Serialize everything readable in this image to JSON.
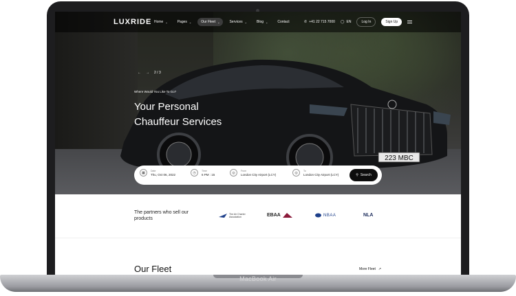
{
  "device_label": "MacBook Air",
  "nav": {
    "logo": "LUXRIDE",
    "menu": [
      {
        "label": "Home",
        "active": false
      },
      {
        "label": "Pages",
        "active": false
      },
      {
        "label": "Our Fleet",
        "active": true
      },
      {
        "label": "Services",
        "active": false
      },
      {
        "label": "Blog",
        "active": false
      },
      {
        "label": "Contact",
        "active": false
      }
    ],
    "phone": "+41 22 715 7000",
    "language": "EN",
    "login": "Log In",
    "signup": "Sign Up"
  },
  "hero": {
    "slide_counter": "2 / 3",
    "eyebrow": "Where Would You Like To Go?",
    "title_line1": "Your Personal",
    "title_line2": "Chauffeur Services",
    "plate": "223 MBC"
  },
  "search": {
    "date": {
      "label": "Date",
      "value": "Thu, Oct 06, 2022"
    },
    "time": {
      "label": "Time",
      "value": "6 PM : 15"
    },
    "from": {
      "label": "From",
      "value": "London City Airport (LCY)"
    },
    "to": {
      "label": "To",
      "value": "London City Airport (LCY)"
    },
    "button": "Search"
  },
  "partners": {
    "title": "The partners who sell our products",
    "logos": [
      "The Air Charter Association",
      "EBAA",
      "NBAA",
      "NLA"
    ]
  },
  "fleet": {
    "title": "Our Fleet",
    "more": "More Fleet"
  },
  "colors": {
    "accent": "#0d0d0d",
    "ebaa": "#8b1a3a",
    "nbaa": "#1d3f8a"
  }
}
